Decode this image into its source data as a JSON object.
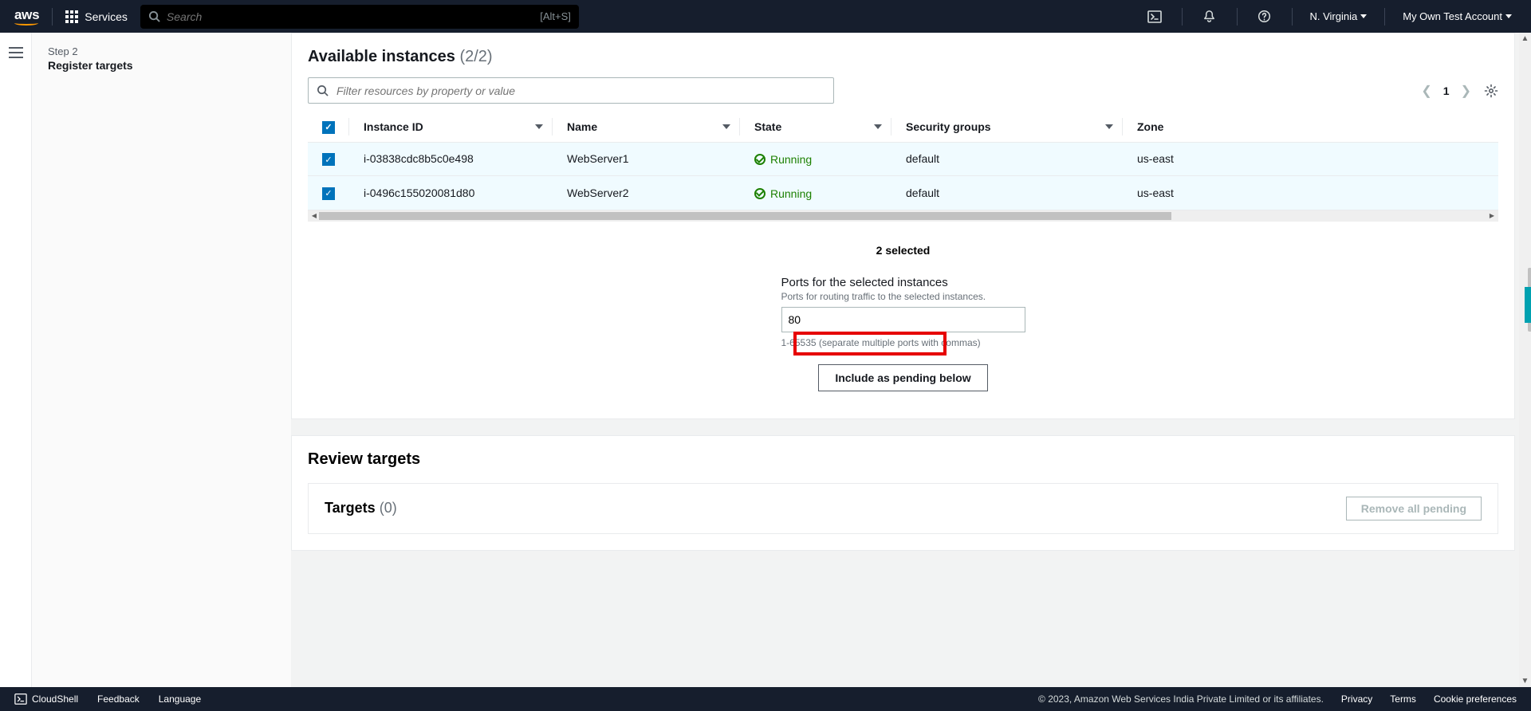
{
  "nav": {
    "services": "Services",
    "search_placeholder": "Search",
    "search_hint": "[Alt+S]",
    "region": "N. Virginia",
    "account": "My Own Test Account"
  },
  "sidebar": {
    "step_label": "Step 2",
    "step_title": "Register targets"
  },
  "available": {
    "title": "Available instances",
    "count": "(2/2)",
    "filter_placeholder": "Filter resources by property or value",
    "page": "1",
    "columns": {
      "instance_id": "Instance ID",
      "name": "Name",
      "state": "State",
      "security_groups": "Security groups",
      "zone": "Zone"
    },
    "rows": [
      {
        "id": "i-03838cdc8b5c0e498",
        "name": "WebServer1",
        "state": "Running",
        "sg": "default",
        "zone": "us-east"
      },
      {
        "id": "i-0496c155020081d80",
        "name": "WebServer2",
        "state": "Running",
        "sg": "default",
        "zone": "us-east"
      }
    ]
  },
  "ports": {
    "selected": "2 selected",
    "label": "Ports for the selected instances",
    "desc": "Ports for routing traffic to the selected instances.",
    "value": "80",
    "hint": "1-65535 (separate multiple ports with commas)",
    "button": "Include as pending below"
  },
  "review": {
    "title": "Review targets",
    "targets_title": "Targets",
    "targets_count": "(0)",
    "remove": "Remove all pending"
  },
  "footer": {
    "cloudshell": "CloudShell",
    "feedback": "Feedback",
    "language": "Language",
    "copyright": "© 2023, Amazon Web Services India Private Limited or its affiliates.",
    "privacy": "Privacy",
    "terms": "Terms",
    "cookies": "Cookie preferences"
  }
}
